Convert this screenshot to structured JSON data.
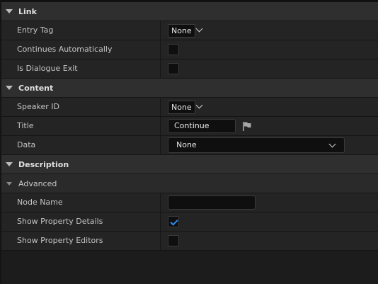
{
  "sections": {
    "link": "Link",
    "content": "Content",
    "description": "Description",
    "advanced": "Advanced"
  },
  "link": {
    "entry_tag": {
      "label": "Entry Tag",
      "value": "None"
    },
    "continues_automatically": {
      "label": "Continues Automatically",
      "checked": false
    },
    "is_dialogue_exit": {
      "label": "Is Dialogue Exit",
      "checked": false
    }
  },
  "content": {
    "speaker_id": {
      "label": "Speaker ID",
      "value": "None"
    },
    "title": {
      "label": "Title",
      "value": "Continue",
      "icon": "flag-icon"
    },
    "data": {
      "label": "Data",
      "value": "None"
    }
  },
  "advanced": {
    "node_name": {
      "label": "Node Name",
      "value": ""
    },
    "show_property_details": {
      "label": "Show Property Details",
      "checked": true
    },
    "show_property_editors": {
      "label": "Show Property Editors",
      "checked": false
    }
  },
  "colors": {
    "accent": "#2f8cf0"
  }
}
